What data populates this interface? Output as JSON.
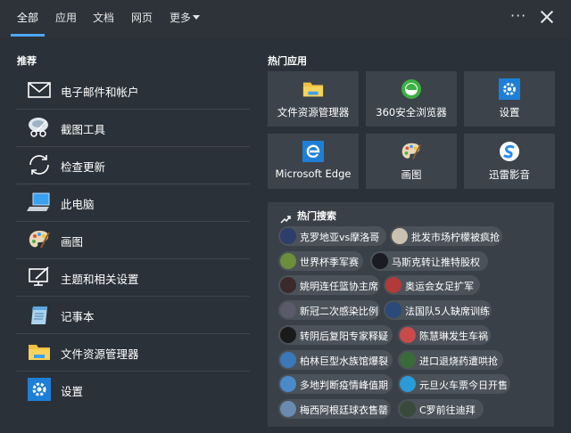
{
  "tabs": [
    {
      "label": "全部",
      "active": true
    },
    {
      "label": "应用"
    },
    {
      "label": "文档"
    },
    {
      "label": "网页"
    },
    {
      "label": "更多"
    }
  ],
  "accent_color": "#4ea8ff",
  "recommended": {
    "title": "推荐",
    "items": [
      {
        "label": "电子邮件和帐户",
        "icon": "mail-icon"
      },
      {
        "label": "截图工具",
        "icon": "snipping-tool-icon"
      },
      {
        "label": "检查更新",
        "icon": "sync-icon"
      },
      {
        "label": "此电脑",
        "icon": "computer-icon"
      },
      {
        "label": "画图",
        "icon": "paint-palette-icon"
      },
      {
        "label": "主题和相关设置",
        "icon": "theme-icon"
      },
      {
        "label": "记事本",
        "icon": "notepad-icon"
      },
      {
        "label": "文件资源管理器",
        "icon": "folder-icon"
      },
      {
        "label": "设置",
        "icon": "gear-icon"
      }
    ]
  },
  "hot_apps": {
    "title": "热门应用",
    "items": [
      {
        "label": "文件资源管理器",
        "icon": "folder-icon"
      },
      {
        "label": "360安全浏览器",
        "icon": "browser-360-icon"
      },
      {
        "label": "设置",
        "icon": "gear-icon"
      },
      {
        "label": "Microsoft Edge",
        "icon": "edge-icon"
      },
      {
        "label": "画图",
        "icon": "paint-palette-icon"
      },
      {
        "label": "迅雷影音",
        "icon": "xunlei-icon"
      }
    ]
  },
  "hot_search": {
    "title": "热门搜索",
    "items": [
      {
        "label": "克罗地亚vs摩洛哥"
      },
      {
        "label": "批发市场柠檬被疯抢"
      },
      {
        "label": "世界杯季军赛"
      },
      {
        "label": "马斯克转让推特股权"
      },
      {
        "label": "姚明连任篮协主席"
      },
      {
        "label": "奥运会女足扩军"
      },
      {
        "label": "新冠二次感染比例"
      },
      {
        "label": "法国队5人缺席训练"
      },
      {
        "label": "转阴后复阳专家释疑"
      },
      {
        "label": "陈慧琳发生车祸"
      },
      {
        "label": "柏林巨型水族馆爆裂"
      },
      {
        "label": "进口退烧药遭哄抢"
      },
      {
        "label": "多地判断疫情峰值期"
      },
      {
        "label": "元旦火车票今日开售"
      },
      {
        "label": "梅西阿根廷球衣售罄"
      },
      {
        "label": "C罗前往迪拜"
      }
    ]
  }
}
